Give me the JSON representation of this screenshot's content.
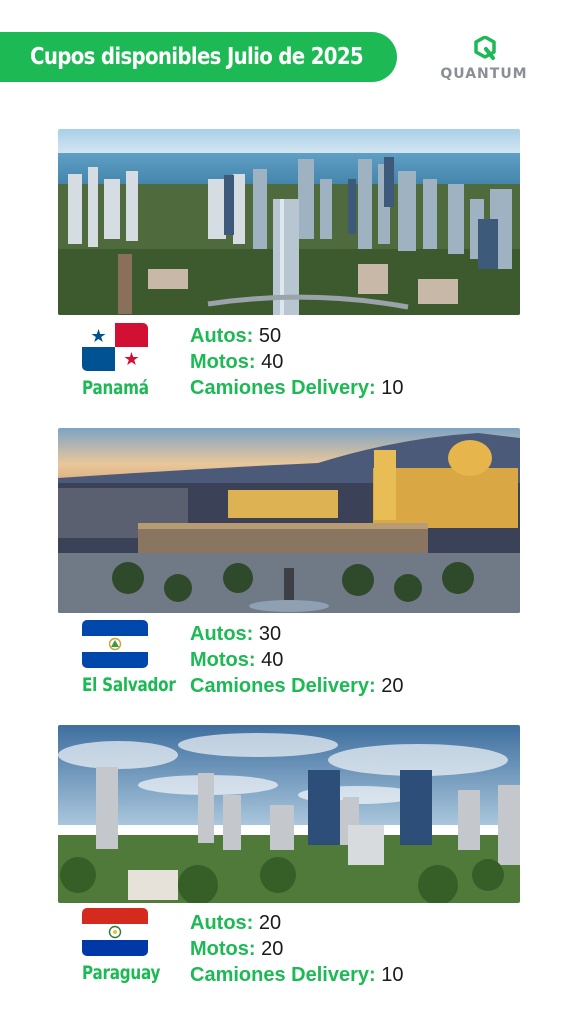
{
  "header": {
    "title": "Cupos disponibles Julio de 2025",
    "brand": "QUANTUM",
    "brand_color": "#1db954"
  },
  "sections": [
    {
      "country": "Panamá",
      "flag": "panama-flag",
      "photo": "panama-city-skyline-photo",
      "stats": [
        {
          "label": "Autos:",
          "value": "50"
        },
        {
          "label": "Motos:",
          "value": "40"
        },
        {
          "label": "Camiones Delivery:",
          "value": "10"
        }
      ]
    },
    {
      "country": "El Salvador",
      "flag": "el-salvador-flag",
      "photo": "san-salvador-plaza-photo",
      "stats": [
        {
          "label": "Autos:",
          "value": "30"
        },
        {
          "label": "Motos:",
          "value": "40"
        },
        {
          "label": "Camiones Delivery:",
          "value": "20"
        }
      ]
    },
    {
      "country": "Paraguay",
      "flag": "paraguay-flag",
      "photo": "asuncion-skyline-photo",
      "stats": [
        {
          "label": "Autos:",
          "value": "20"
        },
        {
          "label": "Motos:",
          "value": "20"
        },
        {
          "label": "Camiones Delivery:",
          "value": "10"
        }
      ]
    }
  ]
}
